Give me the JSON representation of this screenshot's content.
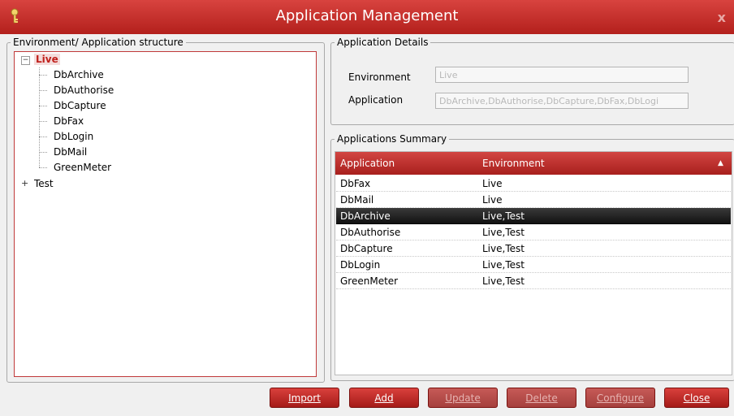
{
  "window": {
    "title": "Application Management",
    "close_glyph": "x"
  },
  "tree_panel": {
    "legend": "Environment/ Application structure",
    "nodes": [
      {
        "label": "Live",
        "expanded": true,
        "children": [
          "DbArchive",
          "DbAuthorise",
          "DbCapture",
          "DbFax",
          "DbLogin",
          "DbMail",
          "GreenMeter"
        ]
      },
      {
        "label": "Test",
        "expanded": false
      }
    ],
    "expand_glyph": "+",
    "collapse_glyph": "−"
  },
  "details_panel": {
    "legend": "Application Details",
    "environment_label": "Environment",
    "environment_value": "Live",
    "application_label": "Application",
    "application_value": "DbArchive,DbAuthorise,DbCapture,DbFax,DbLogi"
  },
  "summary_panel": {
    "legend": "Applications Summary",
    "columns": [
      "Application",
      "Environment"
    ],
    "sort_indicator": "▲",
    "rows": [
      {
        "application": "DbFax",
        "environment": "Live"
      },
      {
        "application": "DbMail",
        "environment": "Live"
      },
      {
        "application": "DbArchive",
        "environment": "Live,Test",
        "selected": true
      },
      {
        "application": "DbAuthorise",
        "environment": "Live,Test"
      },
      {
        "application": "DbCapture",
        "environment": "Live,Test"
      },
      {
        "application": "DbLogin",
        "environment": "Live,Test"
      },
      {
        "application": "GreenMeter",
        "environment": "Live,Test"
      }
    ]
  },
  "buttons": {
    "import": "Import",
    "add": "Add",
    "update": "Update",
    "delete": "Delete",
    "configure": "Configure",
    "close": "Close"
  },
  "colors": {
    "accent": "#b3201c",
    "selected_row": "#1a1a1a"
  }
}
